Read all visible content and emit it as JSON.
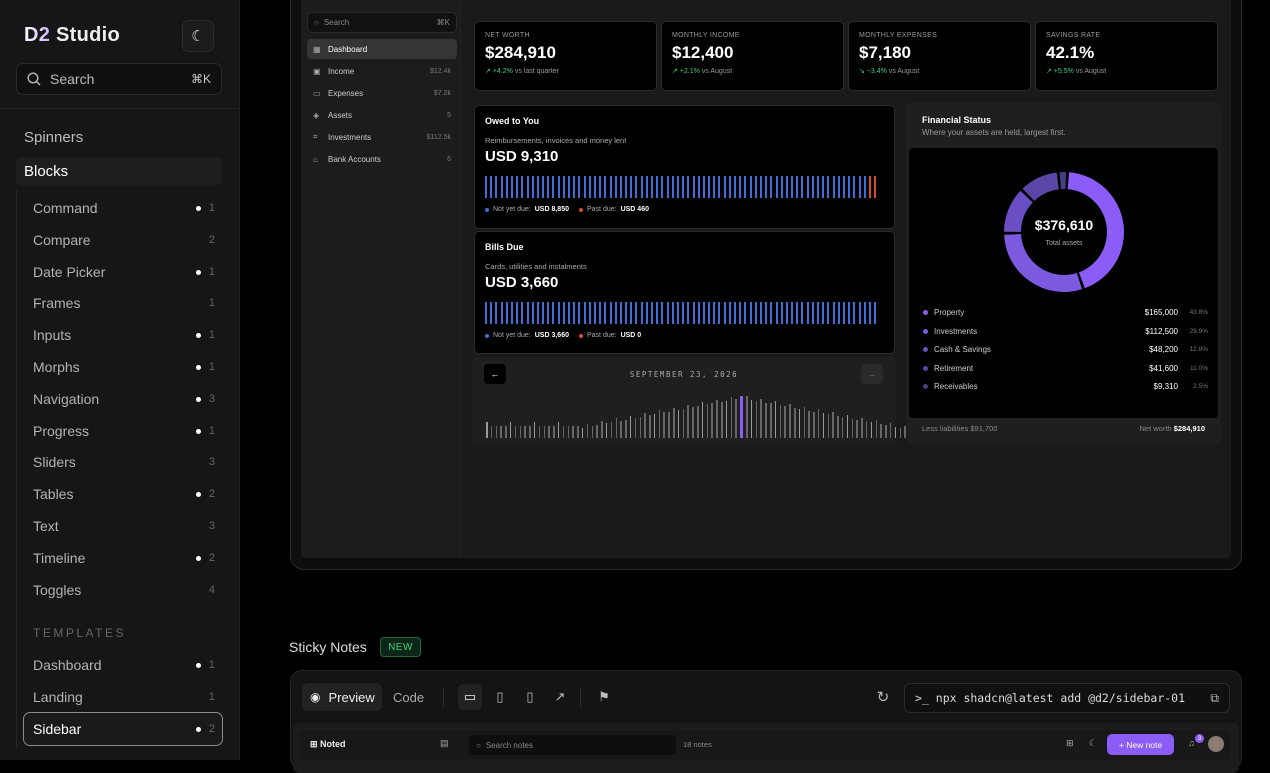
{
  "sidebar": {
    "brand": "D2 Studio",
    "brand_d2": "D2",
    "brand_rest": "Studio",
    "theme_icon": "moon-icon",
    "search_placeholder": "Search",
    "search_kbd": "⌘K",
    "top_items": [
      "Spinners",
      "Blocks"
    ],
    "blocks": [
      {
        "label": "Command",
        "dot": true,
        "count": "1"
      },
      {
        "label": "Compare",
        "dot": false,
        "count": "2"
      },
      {
        "label": "Date Picker",
        "dot": true,
        "count": "1"
      },
      {
        "label": "Frames",
        "dot": false,
        "count": "1"
      },
      {
        "label": "Inputs",
        "dot": true,
        "count": "1"
      },
      {
        "label": "Morphs",
        "dot": true,
        "count": "1"
      },
      {
        "label": "Navigation",
        "dot": true,
        "count": "3"
      },
      {
        "label": "Progress",
        "dot": true,
        "count": "1"
      },
      {
        "label": "Sliders",
        "dot": false,
        "count": "3"
      },
      {
        "label": "Tables",
        "dot": true,
        "count": "2"
      },
      {
        "label": "Text",
        "dot": false,
        "count": "3"
      },
      {
        "label": "Timeline",
        "dot": true,
        "count": "2"
      },
      {
        "label": "Toggles",
        "dot": false,
        "count": "4"
      }
    ],
    "templates_heading": "TEMPLATES",
    "templates": [
      {
        "label": "Dashboard",
        "dot": true,
        "count": "1"
      },
      {
        "label": "Landing",
        "dot": false,
        "count": "1"
      },
      {
        "label": "Sidebar",
        "dot": true,
        "count": "2"
      }
    ]
  },
  "preview": {
    "search": "Search",
    "search_kbd": "⌘K",
    "nav": [
      {
        "label": "Dashboard",
        "icon": "grid-icon",
        "value": ""
      },
      {
        "label": "Income",
        "icon": "wallet-icon",
        "value": "$12.4k"
      },
      {
        "label": "Expenses",
        "icon": "card-icon",
        "value": "$7.2k"
      },
      {
        "label": "Assets",
        "icon": "layers-icon",
        "value": "5"
      },
      {
        "label": "Investments",
        "icon": "chart-icon",
        "value": "$112.5k"
      },
      {
        "label": "Bank Accounts",
        "icon": "bank-icon",
        "value": "6"
      }
    ],
    "stats": [
      {
        "label": "NET WORTH",
        "value": "$284,910",
        "change": "↗ +4.2%",
        "context": "vs last quarter"
      },
      {
        "label": "MONTHLY INCOME",
        "value": "$12,400",
        "change": "↗ +2.1%",
        "context": "vs August"
      },
      {
        "label": "MONTHLY EXPENSES",
        "value": "$7,180",
        "change": "↘ −3.4%",
        "context": "vs August"
      },
      {
        "label": "SAVINGS RATE",
        "value": "42.1%",
        "change": "↗ +5.5%",
        "context": "vs August"
      }
    ],
    "owed": {
      "title": "Owed to You",
      "subtitle": "Reimbursements, invoices and money lent",
      "amount": "USD 9,310",
      "legend_a_label": "Not yet due:",
      "legend_a_value": "USD 8,850",
      "legend_b_label": "Past due:",
      "legend_b_value": "USD 460",
      "blue_color": "#3f6fd6",
      "red_color": "#d9492e"
    },
    "bills": {
      "title": "Bills Due",
      "subtitle": "Cards, utilities and instalments",
      "amount": "USD 3,660",
      "legend_a_label": "Not yet due:",
      "legend_a_value": "USD 3,660",
      "legend_b_label": "Past due:",
      "legend_b_value": "USD 0"
    },
    "date_label": "SEPTEMBER 23, 2026",
    "financial": {
      "title": "Financial Status",
      "subtitle": "Where your assets are held, largest first.",
      "total": "$376,610",
      "total_label": "Total assets",
      "rows": [
        {
          "label": "Property",
          "value": "$165,000",
          "pct": "43.8%",
          "color": "#8b5cf6"
        },
        {
          "label": "Investments",
          "value": "$112,500",
          "pct": "29.9%",
          "color": "#7c5ae0"
        },
        {
          "label": "Cash & Savings",
          "value": "$48,200",
          "pct": "12.8%",
          "color": "#6a4fc4"
        },
        {
          "label": "Retirement",
          "value": "$41,600",
          "pct": "11.0%",
          "color": "#5a46a6"
        },
        {
          "label": "Receivables",
          "value": "$9,310",
          "pct": "2.5%",
          "color": "#4a3d85"
        }
      ],
      "liabilities": "Less liabilities $91,700",
      "net_label": "Net worth",
      "net_value": "$284,910"
    }
  },
  "section": {
    "title": "Sticky Notes",
    "badge": "NEW"
  },
  "toolbar": {
    "preview_label": "Preview",
    "code_label": "Code",
    "command": ">_ npx shadcn@latest add @d2/sidebar-01"
  },
  "sticky": {
    "app_name": "Noted",
    "search_placeholder": "Search notes",
    "count": "18 notes",
    "new_note": "+ New note",
    "badge_count": "3"
  },
  "colors": {
    "accent": "#8b5cf6",
    "positive": "#3ccf7a",
    "new_badge": "#3fd07c"
  }
}
